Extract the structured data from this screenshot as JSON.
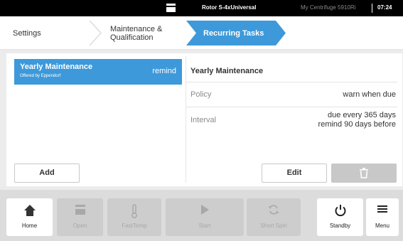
{
  "status": {
    "rotor": "Rotor S-4xUniversal",
    "device": "My Centrifuge 5910Ri",
    "time": "07:24"
  },
  "breadcrumb": {
    "items": [
      "Settings",
      "Maintenance &",
      "Qualification",
      "Recurring Tasks"
    ]
  },
  "tasks": [
    {
      "title": "Yearly Maintenance",
      "subtitle": "Offered by Eppendorf",
      "tag": "remind"
    }
  ],
  "detail": {
    "title": "Yearly Maintenance",
    "policy_label": "Policy",
    "policy_value": "warn when due",
    "interval_label": "Interval",
    "interval_line1": "due every 365 days",
    "interval_line2": "remind 90 days before"
  },
  "buttons": {
    "add": "Add",
    "edit": "Edit"
  },
  "toolbar": {
    "home": "Home",
    "open": "Open",
    "fasttemp": "FastTemp",
    "start": "Start",
    "shortspin": "Short Spin",
    "standby": "Standby",
    "menu": "Menu"
  },
  "colors": {
    "accent": "#3d99d9",
    "statusbar": "#000000"
  }
}
